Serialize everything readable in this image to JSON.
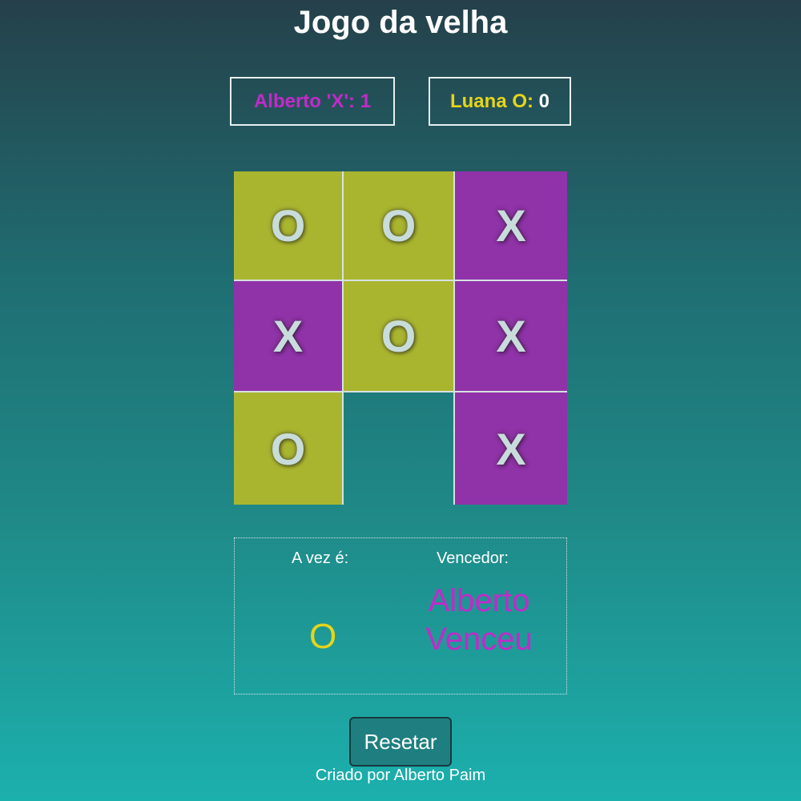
{
  "title": "Jogo da velha",
  "scoreboard": {
    "player_x": {
      "label": "Alberto 'X': ",
      "score": "1",
      "color": "#c22ac9"
    },
    "player_o": {
      "label": "Luana O: ",
      "score": "0",
      "color": "#e5d51a"
    }
  },
  "board": {
    "cells": [
      "O",
      "O",
      "X",
      "X",
      "O",
      "X",
      "O",
      "",
      "X"
    ],
    "colors": {
      "o_fill": "#aab52f",
      "x_fill": "#9032a8"
    }
  },
  "status": {
    "turn_label": "A vez é:",
    "turn_value": "O",
    "winner_label": "Vencedor:",
    "winner_value": "Alberto Venceu"
  },
  "controls": {
    "reset_label": "Resetar"
  },
  "footer": {
    "credit": "Criado por Alberto Paim"
  }
}
